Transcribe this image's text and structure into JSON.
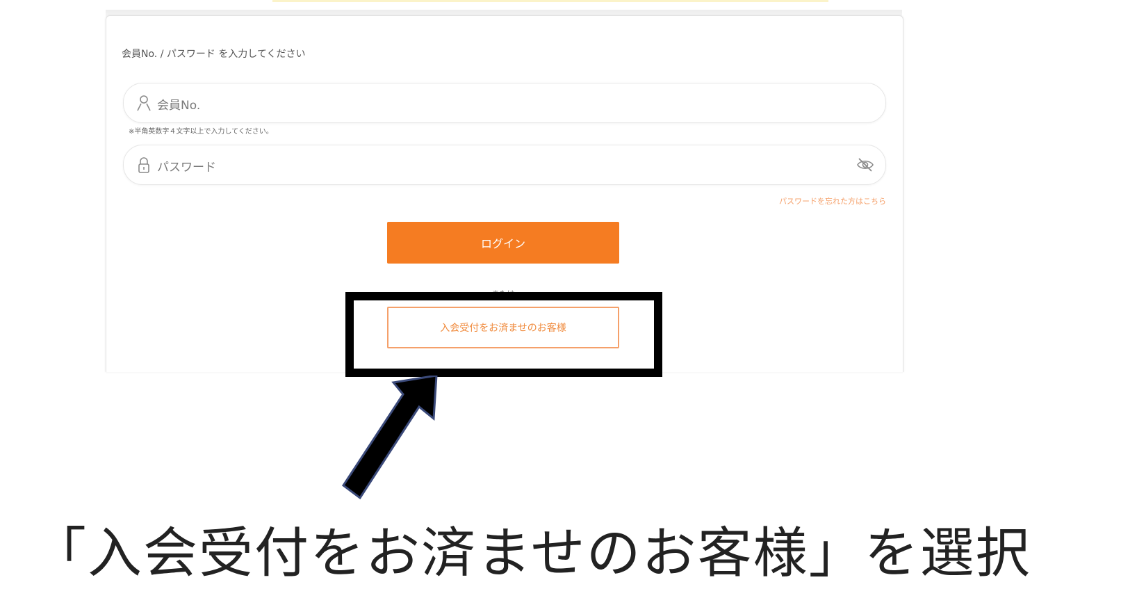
{
  "login_form": {
    "instruction": "会員No. / パスワード を入力してください",
    "member_no": {
      "placeholder": "会員No.",
      "icon": "person-icon",
      "hint": "※半角英数字４文字以上で入力してください。"
    },
    "password": {
      "placeholder": "パスワード",
      "icon": "lock-icon",
      "toggle_icon": "eye-slash-icon"
    },
    "forgot_password_link": "パスワードを忘れた方はこちら",
    "login_button": "ログイン",
    "divider_text": "または",
    "registered_customer_button": "入会受付をお済ませのお客様"
  },
  "annotation": {
    "caption": "「入会受付をお済ませのお客様」を選択",
    "highlight_color": "#000000",
    "arrow_color": "#000000",
    "arrow_outline_color": "#3b4a7a"
  },
  "colors": {
    "accent": "#f57c22",
    "accent_light": "#f5a06a"
  }
}
